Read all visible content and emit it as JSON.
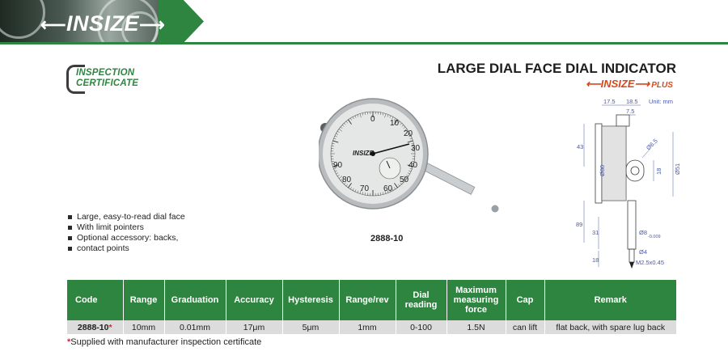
{
  "banner": {
    "brand": "INSIZE"
  },
  "certificate": {
    "line1": "INSPECTION",
    "line2": "CERTIFICATE"
  },
  "header": {
    "title": "LARGE DIAL FACE DIAL INDICATOR",
    "subbrand": "INSIZE",
    "subbrand_plus": "PLUS"
  },
  "product": {
    "model": "2888-10",
    "dial_numbers": [
      "0",
      "10",
      "20",
      "30",
      "40",
      "50",
      "60",
      "70",
      "80",
      "90"
    ],
    "brand_on_dial": "INSIZE"
  },
  "drawing": {
    "unit": "Unit: mm",
    "dims": {
      "d17_5": "17.5",
      "d18_5": "18.5",
      "d7_5": "7.5",
      "d43": "43",
      "d80": "Ø80",
      "d6_5": "Ø6.5",
      "d18": "18",
      "d51": "Ø51",
      "d89": "89",
      "d31": "31",
      "d8": "Ø8",
      "d8_tol": "-0.009",
      "d4": "Ø4",
      "thread": "M2.5x0.45",
      "d18b": "18"
    }
  },
  "features": [
    "Large, easy-to-read dial face",
    "With limit pointers",
    "Optional accessory: backs,",
    "contact points"
  ],
  "table": {
    "headers": {
      "code": "Code",
      "range": "Range",
      "graduation": "Graduation",
      "accuracy": "Accuracy",
      "hysteresis": "Hysteresis",
      "range_rev": "Range/rev",
      "dial_1": "Dial",
      "dial_2": "reading",
      "force_1": "Maximum",
      "force_2": "measuring",
      "force_3": "force",
      "cap": "Cap",
      "remark": "Remark"
    },
    "row": {
      "code": "2888-10",
      "star": "*",
      "range": "10mm",
      "graduation": "0.01mm",
      "accuracy": "17μm",
      "hysteresis": "5μm",
      "range_rev": "1mm",
      "dial_reading": "0-100",
      "force": "1.5N",
      "cap": "can lift",
      "remark": "flat back, with spare lug back"
    }
  },
  "footnote": {
    "star": "*",
    "text": "Supplied with manufacturer inspection certificate"
  },
  "colors": {
    "brand_green": "#2e8540",
    "accent_orange": "#d6491b",
    "star_red": "#d3263a",
    "dim_blue": "#4a5aa8"
  }
}
